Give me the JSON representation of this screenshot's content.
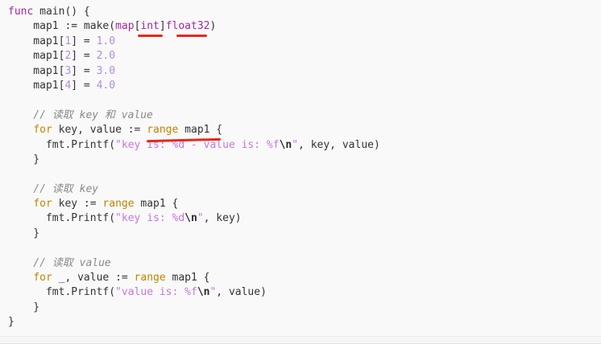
{
  "code": {
    "lines": [
      {
        "segments": [
          {
            "t": "func",
            "c": "kw-func"
          },
          {
            "t": " main() {",
            "c": "op"
          }
        ]
      },
      {
        "segments": [
          {
            "t": "    map1 ",
            "c": "op"
          },
          {
            "t": ":=",
            "c": "op"
          },
          {
            "t": " make(",
            "c": "fn"
          },
          {
            "t": "map",
            "c": "type"
          },
          {
            "t": "[",
            "c": "op"
          },
          {
            "t": "int",
            "c": "type"
          },
          {
            "t": "]",
            "c": "op"
          },
          {
            "t": "float32",
            "c": "type"
          },
          {
            "t": ")",
            "c": "op"
          }
        ]
      },
      {
        "segments": [
          {
            "t": "    map1[",
            "c": "op"
          },
          {
            "t": "1",
            "c": "num"
          },
          {
            "t": "] = ",
            "c": "op"
          },
          {
            "t": "1.0",
            "c": "num"
          }
        ]
      },
      {
        "segments": [
          {
            "t": "    map1[",
            "c": "op"
          },
          {
            "t": "2",
            "c": "num"
          },
          {
            "t": "] = ",
            "c": "op"
          },
          {
            "t": "2.0",
            "c": "num"
          }
        ]
      },
      {
        "segments": [
          {
            "t": "    map1[",
            "c": "op"
          },
          {
            "t": "3",
            "c": "num"
          },
          {
            "t": "] = ",
            "c": "op"
          },
          {
            "t": "3.0",
            "c": "num"
          }
        ]
      },
      {
        "segments": [
          {
            "t": "    map1[",
            "c": "op"
          },
          {
            "t": "4",
            "c": "num"
          },
          {
            "t": "] = ",
            "c": "op"
          },
          {
            "t": "4.0",
            "c": "num"
          }
        ]
      },
      {
        "segments": [
          {
            "t": "",
            "c": "op"
          }
        ]
      },
      {
        "segments": [
          {
            "t": "    // 读取 key 和 value",
            "c": "comment"
          }
        ]
      },
      {
        "segments": [
          {
            "t": "    ",
            "c": "op"
          },
          {
            "t": "for",
            "c": "kw-for"
          },
          {
            "t": " key, value := ",
            "c": "op"
          },
          {
            "t": "range",
            "c": "kw-range"
          },
          {
            "t": " map1 {",
            "c": "op"
          }
        ]
      },
      {
        "segments": [
          {
            "t": "      fmt.Printf(",
            "c": "fn"
          },
          {
            "t": "\"key is: %d - value is: %f",
            "c": "str"
          },
          {
            "t": "\\n",
            "c": "esc"
          },
          {
            "t": "\"",
            "c": "str"
          },
          {
            "t": ", key, value)",
            "c": "op"
          }
        ]
      },
      {
        "segments": [
          {
            "t": "    }",
            "c": "op"
          }
        ]
      },
      {
        "segments": [
          {
            "t": "",
            "c": "op"
          }
        ]
      },
      {
        "segments": [
          {
            "t": "    // 读取 key",
            "c": "comment"
          }
        ]
      },
      {
        "segments": [
          {
            "t": "    ",
            "c": "op"
          },
          {
            "t": "for",
            "c": "kw-for"
          },
          {
            "t": " key := ",
            "c": "op"
          },
          {
            "t": "range",
            "c": "kw-range"
          },
          {
            "t": " map1 {",
            "c": "op"
          }
        ]
      },
      {
        "segments": [
          {
            "t": "      fmt.Printf(",
            "c": "fn"
          },
          {
            "t": "\"key is: %d",
            "c": "str"
          },
          {
            "t": "\\n",
            "c": "esc"
          },
          {
            "t": "\"",
            "c": "str"
          },
          {
            "t": ", key)",
            "c": "op"
          }
        ]
      },
      {
        "segments": [
          {
            "t": "    }",
            "c": "op"
          }
        ]
      },
      {
        "segments": [
          {
            "t": "",
            "c": "op"
          }
        ]
      },
      {
        "segments": [
          {
            "t": "    // 读取 value",
            "c": "comment"
          }
        ]
      },
      {
        "segments": [
          {
            "t": "    ",
            "c": "op"
          },
          {
            "t": "for",
            "c": "kw-for"
          },
          {
            "t": " _, value := ",
            "c": "op"
          },
          {
            "t": "range",
            "c": "kw-range"
          },
          {
            "t": " map1 {",
            "c": "op"
          }
        ]
      },
      {
        "segments": [
          {
            "t": "      fmt.Printf(",
            "c": "fn"
          },
          {
            "t": "\"value is: %f",
            "c": "str"
          },
          {
            "t": "\\n",
            "c": "esc"
          },
          {
            "t": "\"",
            "c": "str"
          },
          {
            "t": ", value)",
            "c": "op"
          }
        ]
      },
      {
        "segments": [
          {
            "t": "    }",
            "c": "op"
          }
        ]
      },
      {
        "segments": [
          {
            "t": "}",
            "c": "op"
          }
        ]
      }
    ]
  },
  "annotation_color": "#e8271b"
}
